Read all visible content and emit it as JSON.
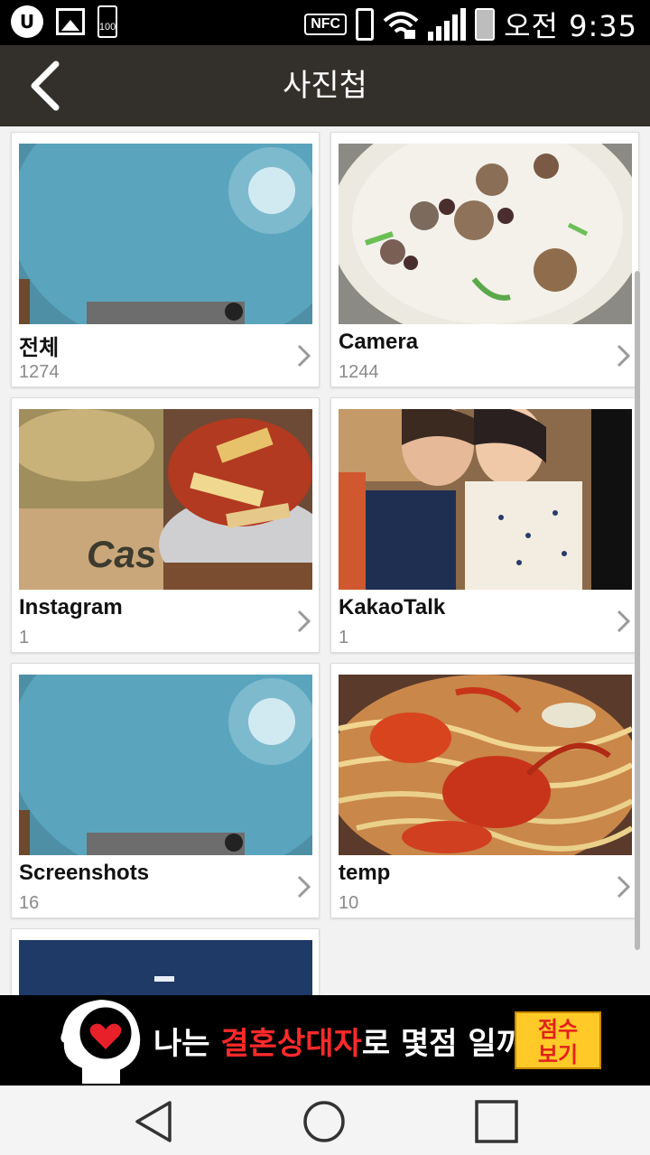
{
  "status_bar": {
    "carrier_icon": "u-plus-logo-icon",
    "battery_small_label": "100",
    "nfc_label": "NFC",
    "time": "오전 9:35"
  },
  "app_bar": {
    "title": "사진첩",
    "back_icon": "chevron-left-icon"
  },
  "albums": [
    {
      "name": "전체",
      "count": "1274"
    },
    {
      "name": "Camera",
      "count": "1244"
    },
    {
      "name": "Instagram",
      "count": "1"
    },
    {
      "name": "KakaoTalk",
      "count": "1"
    },
    {
      "name": "Screenshots",
      "count": "16"
    },
    {
      "name": "temp",
      "count": "10"
    }
  ],
  "ad": {
    "text_before": "나는 ",
    "text_highlight": "결혼상대자",
    "text_after": "로 몇점 일까?",
    "button_line1": "점수",
    "button_line2": "보기",
    "highlight_color": "#ff2a2a",
    "button_color": "#ffc928"
  },
  "nav_bar": {
    "back_icon": "triangle-back-icon",
    "home_icon": "circle-home-icon",
    "recents_icon": "square-recents-icon"
  },
  "colors": {
    "app_bar": "#332f2b",
    "background": "#f2f2f2"
  }
}
